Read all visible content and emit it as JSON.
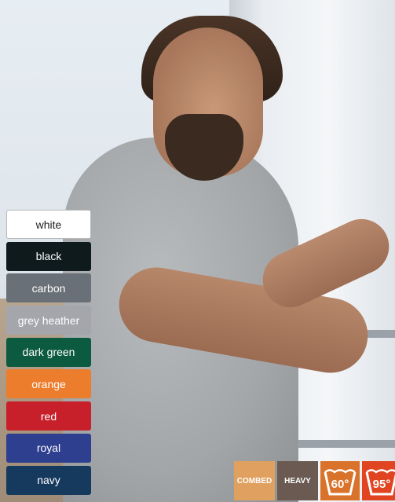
{
  "swatches": [
    {
      "label": "white",
      "color": "#ffffff",
      "light": true
    },
    {
      "label": "black",
      "color": "#0e1a1c"
    },
    {
      "label": "carbon",
      "color": "#6a7077"
    },
    {
      "label": "grey heather",
      "color": "#a4a6ac"
    },
    {
      "label": "dark green",
      "color": "#0c5a40"
    },
    {
      "label": "orange",
      "color": "#ec7d2c"
    },
    {
      "label": "red",
      "color": "#c8202a"
    },
    {
      "label": "royal",
      "color": "#2f3f8f"
    },
    {
      "label": "navy",
      "color": "#153a5e"
    }
  ],
  "badges": {
    "combed": {
      "label": "COMBED",
      "color": "#e0a060"
    },
    "heavy": {
      "label": "HEAVY",
      "color": "#6a5a52"
    },
    "wash60": {
      "temp": "60°",
      "color": "#d9722a",
      "icon": "wash-60-icon"
    },
    "wash95": {
      "temp": "95°",
      "color": "#e04420",
      "icon": "wash-95-icon"
    }
  }
}
